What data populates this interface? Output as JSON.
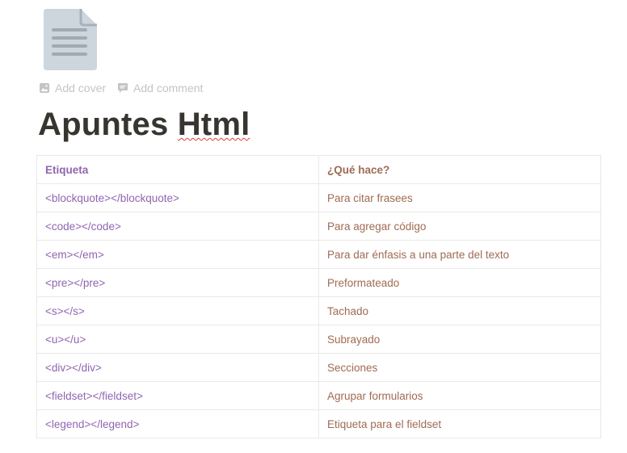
{
  "page": {
    "icon": "document-icon",
    "actions": [
      {
        "label": "Add cover",
        "icon": "image-icon"
      },
      {
        "label": "Add comment",
        "icon": "comment-icon"
      }
    ],
    "title_part1": "Apuntes ",
    "title_part2": "Html"
  },
  "table": {
    "headers": [
      "Etiqueta",
      "¿Qué hace?"
    ],
    "rows": [
      {
        "tag": "<blockquote></blockquote>",
        "desc": "Para citar frasees"
      },
      {
        "tag": "<code></code>",
        "desc": "Para agregar código"
      },
      {
        "tag": "<em></em>",
        "desc": "Para dar énfasis a una parte del texto"
      },
      {
        "tag": "<pre></pre>",
        "desc": "Preformateado"
      },
      {
        "tag": "<s></s>",
        "desc": "Tachado"
      },
      {
        "tag": "<u></u>",
        "desc": "Subrayado"
      },
      {
        "tag": "<div></div>",
        "desc": "Secciones"
      },
      {
        "tag": "<fieldset></fieldset>",
        "desc": "Agrupar formularios"
      },
      {
        "tag": "<legend></legend>",
        "desc": "Etiqueta para el fieldset"
      }
    ]
  },
  "colors": {
    "text": "#37352f",
    "purple": "#9065b0",
    "brown": "#9f6b53",
    "muted": "#c4c4c2",
    "border": "#e9e9e7"
  }
}
